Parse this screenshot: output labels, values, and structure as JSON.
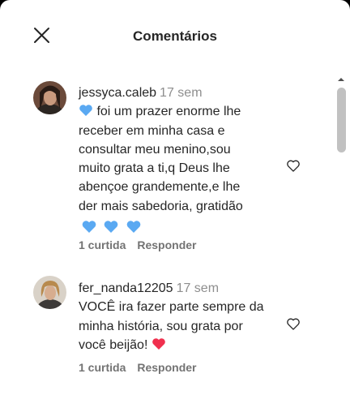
{
  "header": {
    "title": "Comentários",
    "close_icon": "close-icon"
  },
  "colors": {
    "text": "#262626",
    "muted": "#8e8e8e",
    "action": "#737373",
    "blue_heart": "#5aa9f2",
    "red_heart": "#f0304e"
  },
  "comments": [
    {
      "username": "jessyca.caleb",
      "time": "17 sem",
      "text_lines": [
        " foi um prazer enorme lhe",
        "receber em minha casa e",
        "consultar meu menino,sou",
        "muito grata a ti,q Deus lhe",
        "abençoe grandemente,e lhe",
        "der mais sabedoria, gratidão"
      ],
      "leading_emoji": "blue-heart-icon",
      "trailing_emojis": [
        "blue-heart-icon",
        "blue-heart-icon",
        "blue-heart-icon"
      ],
      "likes": "1 curtida",
      "reply": "Responder"
    },
    {
      "username": "fer_nanda12205",
      "time": "17 sem",
      "text_lines": [
        "VOCÊ ira fazer parte sempre da",
        "minha história, sou grata por",
        "você beijão!"
      ],
      "trailing_emojis": [
        "red-heart-icon"
      ],
      "likes": "1 curtida",
      "reply": "Responder"
    }
  ]
}
